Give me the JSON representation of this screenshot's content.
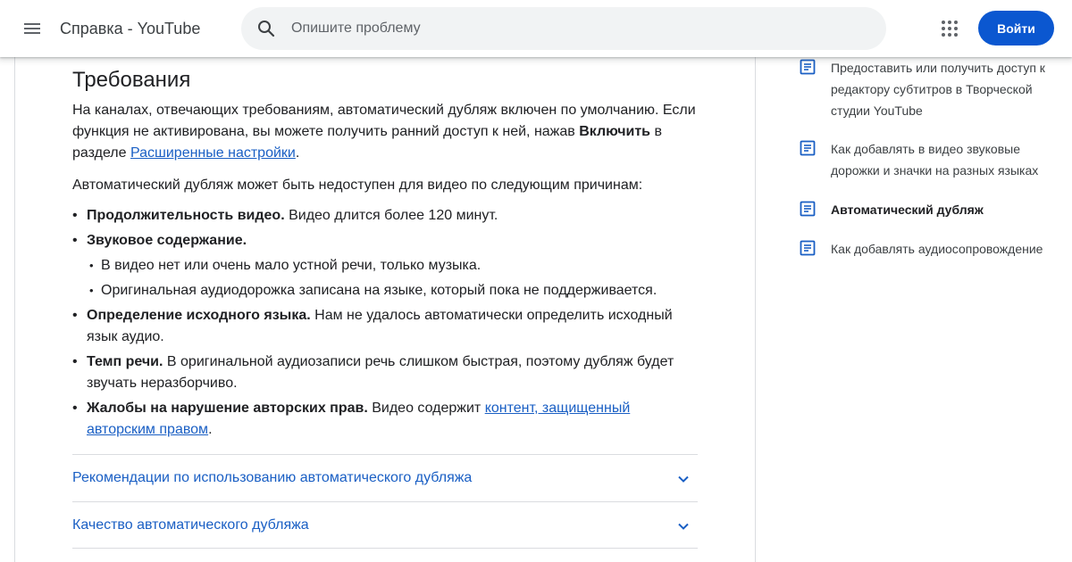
{
  "header": {
    "app_title": "Справка - YouTube",
    "search_placeholder": "Опишите проблему",
    "sign_in_label": "Войти",
    "icons": [
      "menu-icon",
      "search-icon",
      "apps-grid-icon"
    ],
    "accent_color": "#0b57d0"
  },
  "article": {
    "heading": "Требования",
    "p1_text": "На каналах, отвечающих требованиям, автоматический дубляж включен по умолчанию. Если функция не активирована, вы можете получить ранний доступ к ней, нажав ",
    "p1_bold": "Включить",
    "p1_mid": " в разделе ",
    "p1_link": "Расширенные настройки",
    "p1_end": ".",
    "p2_text": "Автоматический дубляж может быть недоступен для видео по следующим причинам:",
    "reasons": [
      {
        "title": "Продолжительность видео.",
        "text": " Видео длится более 120 минут."
      },
      {
        "title": "Звуковое содержание.",
        "sub": [
          "В видео нет или очень мало устной речи, только музыка.",
          "Оригинальная аудиодорожка записана на языке, который пока не поддерживается."
        ]
      },
      {
        "title": "Определение исходного языка.",
        "text": " Нам не удалось автоматически определить исходный язык аудио."
      },
      {
        "title": "Темп речи.",
        "text": " В оригинальной аудиозаписи речь слишком быстрая, поэтому дубляж будет звучать неразборчиво."
      },
      {
        "title": "Жалобы на нарушение авторских прав.",
        "text": " Видео содержит ",
        "link": "контент, защищенный авторским правом",
        "end": "."
      }
    ],
    "accordions": [
      "Рекомендации по использованию автоматического дубляжа",
      "Качество автоматического дубляжа"
    ]
  },
  "sidebar": {
    "items": [
      {
        "label": "Предоставить или получить доступ к редактору субтитров в Творческой студии YouTube",
        "active": false
      },
      {
        "label": "Как добавлять в видео звуковые дорожки и значки на разных языках",
        "active": false
      },
      {
        "label": "Автоматический дубляж",
        "active": true
      },
      {
        "label": "Как добавлять аудиосопровождение",
        "active": false
      }
    ]
  }
}
